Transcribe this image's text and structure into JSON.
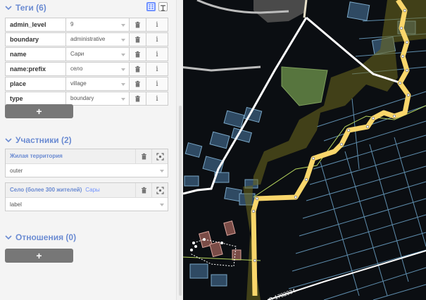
{
  "tags_section": {
    "title": "Теги (6)"
  },
  "tags": [
    {
      "key": "admin_level",
      "value": "9"
    },
    {
      "key": "boundary",
      "value": "administrative"
    },
    {
      "key": "name",
      "value": "Сари"
    },
    {
      "key": "name:prefix",
      "value": "село"
    },
    {
      "key": "place",
      "value": "village"
    },
    {
      "key": "type",
      "value": "boundary"
    }
  ],
  "add_tag": {
    "label": "+"
  },
  "members_section": {
    "title": "Участники (2)"
  },
  "members": [
    {
      "type": "Жилая территория",
      "name": "",
      "role": "outer"
    },
    {
      "type": "Село (более 300 жителей)",
      "name": "Сары",
      "role": "label"
    }
  ],
  "relations_section": {
    "title": "Отношения (0)"
  },
  "add_relation": {
    "label": "+"
  },
  "map": {
    "road_label": "О-1702034"
  },
  "colors": {
    "accent": "#7092ff",
    "boundary": "#f9d66b",
    "map_bg": "#0b0e12",
    "parcel": "#7aa7c7",
    "selected_area": "#6b8f4a"
  }
}
